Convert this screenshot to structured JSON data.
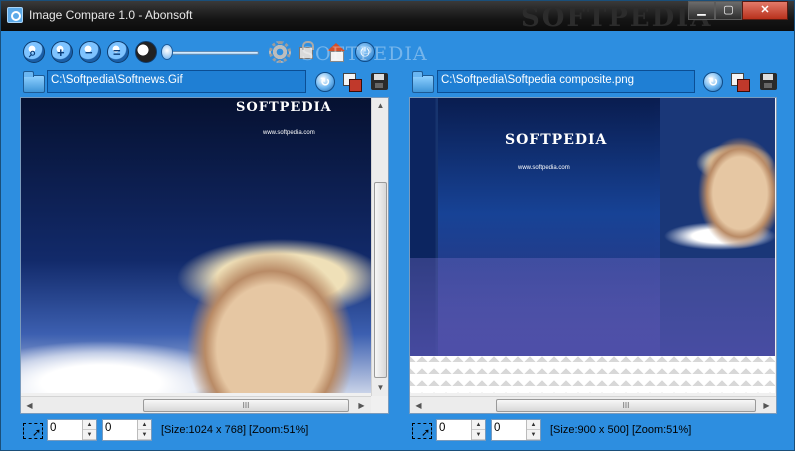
{
  "window": {
    "title": "Image Compare 1.0 - Abonsoft",
    "watermark": "SOFTPEDIA",
    "buttons": {
      "minimize": "▁",
      "maximize": "▢",
      "close": "✕"
    }
  },
  "toolbar": {
    "icons": [
      "zoom-fit-icon",
      "zoom-in-icon",
      "zoom-out-icon",
      "zoom-actual-icon",
      "contrast-icon",
      "gear-icon",
      "lock-icon",
      "home-icon",
      "power-icon"
    ],
    "zoom_in": "+",
    "zoom_out": "−",
    "zoom_actual": "=",
    "contrast": "◐",
    "power": "⏻",
    "slider_level": 0.05,
    "watermark": "SOFTPEDIA"
  },
  "left": {
    "path": "C:\\Softpedia\\Softnews.Gif",
    "status": "[Size:1024 x 768] [Zoom:51%]",
    "offset_x": "0",
    "offset_y": "0",
    "logo": "SOFTPEDIA",
    "url": "www.softpedia.com",
    "hscroll_thumb": "III"
  },
  "right": {
    "path": "C:\\Softpedia\\Softpedia composite.png",
    "status": "[Size:900 x 500] [Zoom:51%]",
    "offset_x": "0",
    "offset_y": "0",
    "logo": "SOFTPEDIA",
    "url": "www.softpedia.com",
    "hscroll_thumb": "III"
  },
  "icons": {
    "refresh": "↻",
    "spin_up": "▲",
    "spin_down": "▼",
    "arrow_up": "▲",
    "arrow_down": "▼",
    "arrow_left": "◀",
    "arrow_right": "▶"
  }
}
